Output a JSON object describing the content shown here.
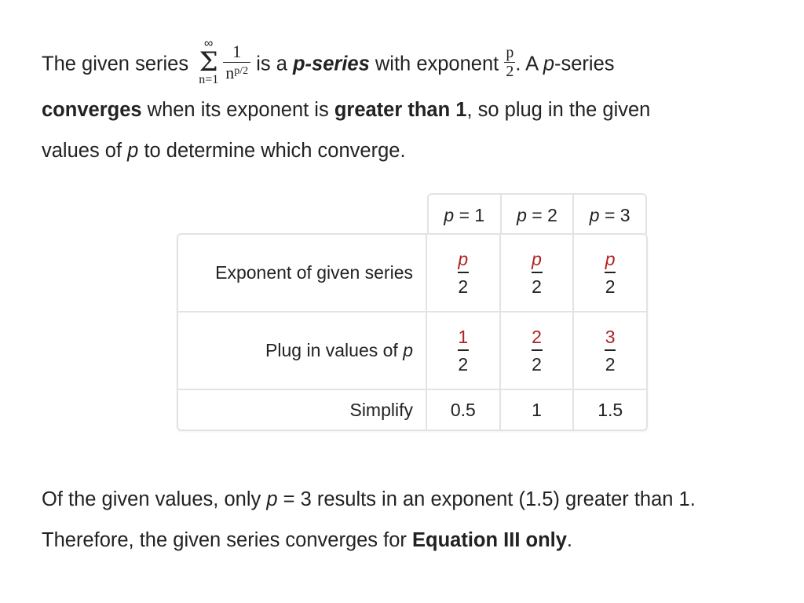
{
  "intro": {
    "text_before_series": "The given series",
    "series": {
      "upper": "∞",
      "symbol": "Σ",
      "lower": "n=1",
      "numerator": "1",
      "denominator_base": "n",
      "denominator_exponent": "p/2"
    },
    "text_is_a": "is a",
    "bold_p_series": "p-series",
    "text_with_exponent": "with exponent",
    "exponent": {
      "numerator": "p",
      "denominator": "2"
    },
    "text_after_exponent": ". A",
    "italic_p": "p",
    "text_series": "-series",
    "bold_converges": "converges",
    "text_when": "when its exponent is",
    "bold_greater": "greater than 1",
    "text_so_plug": ", so plug in the given",
    "text_values_of": "values of",
    "italic_p2": "p",
    "text_to_determine": "to determine which converge."
  },
  "table": {
    "header_var": "p",
    "columns": [
      {
        "label": " = 1"
      },
      {
        "label": " = 2"
      },
      {
        "label": " = 3"
      }
    ],
    "rows": [
      {
        "label": "Exponent of given series",
        "cells": [
          {
            "numerator": "p",
            "denominator": "2"
          },
          {
            "numerator": "p",
            "denominator": "2"
          },
          {
            "numerator": "p",
            "denominator": "2"
          }
        ]
      },
      {
        "label": "Plug in values of ",
        "label_italic": "p",
        "cells": [
          {
            "numerator": "1",
            "denominator": "2"
          },
          {
            "numerator": "2",
            "denominator": "2"
          },
          {
            "numerator": "3",
            "denominator": "2"
          }
        ]
      },
      {
        "label": "Simplify",
        "cells": [
          {
            "value": "0.5"
          },
          {
            "value": "1"
          },
          {
            "value": "1.5"
          }
        ]
      }
    ],
    "highlight_color": "#b22222"
  },
  "conclusion": {
    "text_1": "Of the given values, only",
    "italic_p": "p",
    "text_2": "= 3 results in an exponent (1.5) greater than 1. Therefore, the given series converges for",
    "bold_answer": "Equation III only",
    "text_end": "."
  }
}
